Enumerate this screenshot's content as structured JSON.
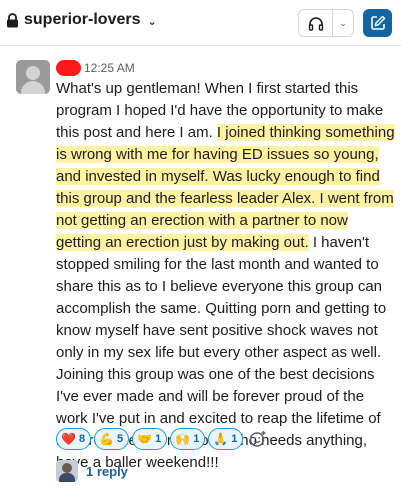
{
  "header": {
    "channel_name": "superior-lovers",
    "chevron": "⌄",
    "huddle_dropdown": "⌄"
  },
  "message": {
    "author_redacted": true,
    "time": "12:25 AM",
    "segments": [
      {
        "text": "What's up gentleman! When I first started this program I hoped I'd have the opportunity to make this post and here I am. ",
        "highlight": false
      },
      {
        "text": "I joined thinking something is wrong with me for having ED issues so young, and invested in myself. Was lucky enough to find this group and the fearless leader Alex. I went from not getting an erection with a partner to now getting an erection just by making out.",
        "highlight": true
      },
      {
        "text": " I haven't stopped smiling for the last month and wanted to share this as to I believe everyone this group can accomplish the same. Quitting porn and getting to know myself have sent positive shock waves not only in my sex life but every other aspect as well. Joining this group was one of the best decisions I've ever made and will be forever proud of the work I've put in and excited to reap the lifetime of rewards. Here for anyone who needs anything, have a baller weekend!!!",
        "highlight": false
      }
    ]
  },
  "reactions": [
    {
      "emoji": "❤️",
      "name": "heart-emoji",
      "count": "8"
    },
    {
      "emoji": "💪",
      "name": "flexed-biceps-emoji",
      "count": "5"
    },
    {
      "emoji": "🤝",
      "name": "handshake-emoji",
      "count": "1"
    },
    {
      "emoji": "🙌",
      "name": "raised-hands-emoji",
      "count": "1"
    },
    {
      "emoji": "🙏",
      "name": "folded-hands-emoji",
      "count": "1"
    }
  ],
  "thread": {
    "reply_label": "1 reply"
  },
  "colors": {
    "link": "#1264a3",
    "highlight": "#fff3a3",
    "compose_button": "#1264a3",
    "reaction_border": "#1d9bd1"
  }
}
